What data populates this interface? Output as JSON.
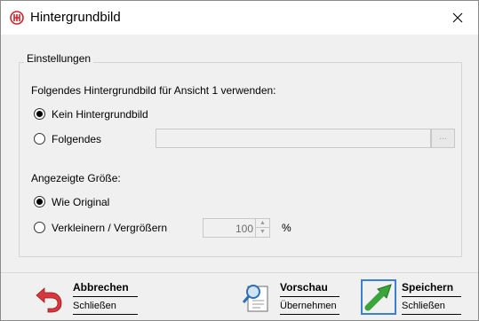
{
  "window": {
    "title": "Hintergrundbild",
    "close_glyph": "×"
  },
  "group": {
    "legend": "Einstellungen",
    "use_label": "Folgendes Hintergrundbild für Ansicht 1 verwenden:",
    "options_image": [
      {
        "label": "Kein Hintergrundbild",
        "checked": true
      },
      {
        "label": "Folgendes",
        "checked": false
      }
    ],
    "file_path": "",
    "browse_label": "...",
    "size_label": "Angezeigte Größe:",
    "options_size": [
      {
        "label": "Wie Original",
        "checked": true
      },
      {
        "label": "Verkleinern / Vergrößern",
        "checked": false
      }
    ],
    "scale_value": "100",
    "scale_unit": "%"
  },
  "actions": {
    "cancel": {
      "title": "Abbrechen",
      "subtitle": "Schließen",
      "icon": "undo-arrow-icon"
    },
    "preview": {
      "title": "Vorschau",
      "subtitle": "Übernehmen",
      "icon": "magnifier-document-icon"
    },
    "save": {
      "title": "Speichern",
      "subtitle": "Schließen",
      "icon": "green-arrow-icon"
    }
  },
  "colors": {
    "app_icon_red": "#d2232a",
    "save_frame": "#3b7fd6",
    "save_arrow": "#3aa53a",
    "cancel_arrow": "#d9363e"
  }
}
